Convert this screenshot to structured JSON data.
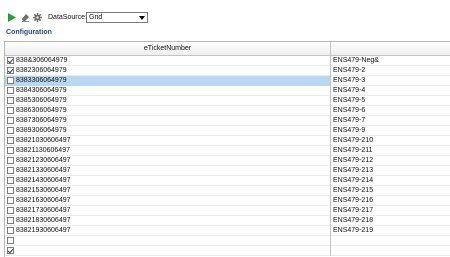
{
  "toolbar": {
    "run_icon": "play-icon",
    "eraser_icon": "eraser-icon",
    "settings_icon": "gear-icon",
    "datasource_label": "DataSource:",
    "datasource_value": "Grid"
  },
  "configuration_label": "Configuration",
  "grid": {
    "columns": [
      "eTicketNumber",
      ""
    ],
    "rows": [
      {
        "checked": true,
        "ticket": "838&306064979",
        "code": "ENS479-Neg&",
        "selected": false
      },
      {
        "checked": true,
        "ticket": "8382306064979",
        "code": "ENS479-2",
        "selected": false
      },
      {
        "checked": false,
        "ticket": "8383306064979",
        "code": "ENS479-3",
        "selected": true
      },
      {
        "checked": false,
        "ticket": "8384306064979",
        "code": "ENS479-4",
        "selected": false
      },
      {
        "checked": false,
        "ticket": "8385306064979",
        "code": "ENS479-5",
        "selected": false
      },
      {
        "checked": false,
        "ticket": "8386306064979",
        "code": "ENS479-6",
        "selected": false
      },
      {
        "checked": false,
        "ticket": "8387306064979",
        "code": "ENS479-7",
        "selected": false
      },
      {
        "checked": false,
        "ticket": "8389306064979",
        "code": "ENS479-9",
        "selected": false
      },
      {
        "checked": false,
        "ticket": "83821030606497",
        "code": "ENS479-210",
        "selected": false
      },
      {
        "checked": false,
        "ticket": "83821130606497",
        "code": "ENS479-211",
        "selected": false
      },
      {
        "checked": false,
        "ticket": "83821230606497",
        "code": "ENS479-212",
        "selected": false
      },
      {
        "checked": false,
        "ticket": "83821330606497",
        "code": "ENS479-213",
        "selected": false
      },
      {
        "checked": false,
        "ticket": "83821430606497",
        "code": "ENS479-214",
        "selected": false
      },
      {
        "checked": false,
        "ticket": "83821530606497",
        "code": "ENS479-215",
        "selected": false
      },
      {
        "checked": false,
        "ticket": "83821630606497",
        "code": "ENS479-216",
        "selected": false
      },
      {
        "checked": false,
        "ticket": "83821730606497",
        "code": "ENS479-217",
        "selected": false
      },
      {
        "checked": false,
        "ticket": "83821830606497",
        "code": "ENS479-218",
        "selected": false
      },
      {
        "checked": false,
        "ticket": "83821930606497",
        "code": "ENS479-219",
        "selected": false
      },
      {
        "checked": false,
        "ticket": "",
        "code": "",
        "selected": false
      },
      {
        "checked": true,
        "ticket": "",
        "code": "",
        "selected": false
      }
    ]
  },
  "colors": {
    "accent": "#2a4d86",
    "selection": "#b7d7f3",
    "run_green": "#21a12b"
  }
}
